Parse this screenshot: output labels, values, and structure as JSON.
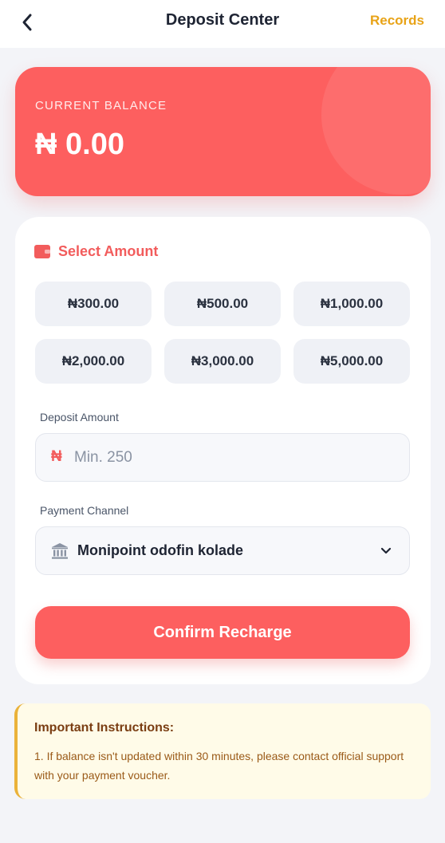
{
  "header": {
    "title": "Deposit Center",
    "records_label": "Records"
  },
  "balance": {
    "label": "CURRENT BALANCE",
    "value": "₦ 0.00"
  },
  "select_amount": {
    "title": "Select Amount",
    "options": [
      "₦300.00",
      "₦500.00",
      "₦1,000.00",
      "₦2,000.00",
      "₦3,000.00",
      "₦5,000.00"
    ]
  },
  "deposit": {
    "label": "Deposit Amount",
    "currency_symbol": "₦",
    "placeholder": "Min. 250",
    "value": ""
  },
  "payment": {
    "label": "Payment Channel",
    "selected": "Monipoint odofin kolade"
  },
  "confirm_label": "Confirm Recharge",
  "instructions": {
    "title": "Important Instructions:",
    "text": "1. If balance isn't updated within 30 minutes, please contact official support with your payment voucher."
  },
  "colors": {
    "accent": "#fd5f5f",
    "records": "#e8a317",
    "instructions_bg": "#fffbe8",
    "instructions_border": "#eab23a"
  },
  "icons": [
    "chevron-left-icon",
    "wallet-icon",
    "bank-icon",
    "chevron-down-icon"
  ]
}
